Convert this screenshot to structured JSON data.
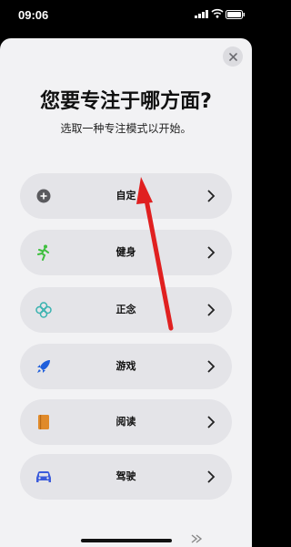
{
  "status_bar": {
    "time": "09:06"
  },
  "sheet": {
    "title": "您要专注于哪方面?",
    "subtitle": "选取一种专注模式以开始。"
  },
  "options": [
    {
      "label": "自定",
      "icon": "plus-circle-icon",
      "color": "#5a5a5e"
    },
    {
      "label": "健身",
      "icon": "running-figure-icon",
      "color": "#3fbf3f"
    },
    {
      "label": "正念",
      "icon": "flower-icon",
      "color": "#3ab3b0"
    },
    {
      "label": "游戏",
      "icon": "rocket-icon",
      "color": "#1f5fdb"
    },
    {
      "label": "阅读",
      "icon": "book-icon",
      "color": "#e08a2a"
    },
    {
      "label": "驾驶",
      "icon": "car-icon",
      "color": "#3b5bdb"
    }
  ],
  "annotation_color": "#e02020"
}
